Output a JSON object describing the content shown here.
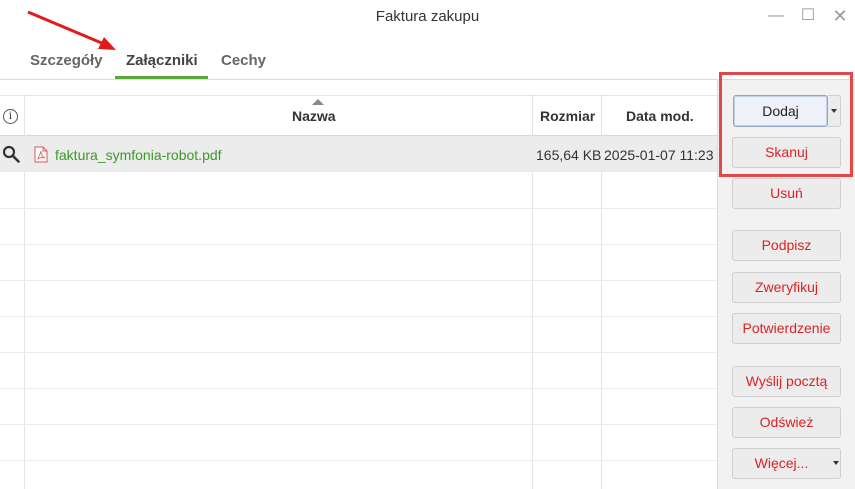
{
  "window": {
    "title": "Faktura zakupu",
    "minimize": "—",
    "maximize": "☐",
    "close": "✕"
  },
  "tabs": [
    {
      "label": "Szczegóły"
    },
    {
      "label": "Załączniki"
    },
    {
      "label": "Cechy"
    }
  ],
  "grid": {
    "headers": {
      "info": "i",
      "name": "Nazwa",
      "size": "Rozmiar",
      "date": "Data mod."
    },
    "rows": [
      {
        "name": "faktura_symfonia-robot.pdf",
        "size": "165,64 KB",
        "date": "2025-01-07 11:23"
      }
    ]
  },
  "actions": {
    "add": "Dodaj",
    "scan": "Skanuj",
    "remove": "Usuń",
    "sign": "Podpisz",
    "verify": "Zweryfikuj",
    "confirmation": "Potwierdzenie",
    "send_mail": "Wyślij pocztą",
    "refresh": "Odśwież",
    "more": "Więcej..."
  },
  "colors": {
    "accent_green": "#5aa83a",
    "action_red": "#d22222",
    "annotation_red": "#e24848"
  }
}
